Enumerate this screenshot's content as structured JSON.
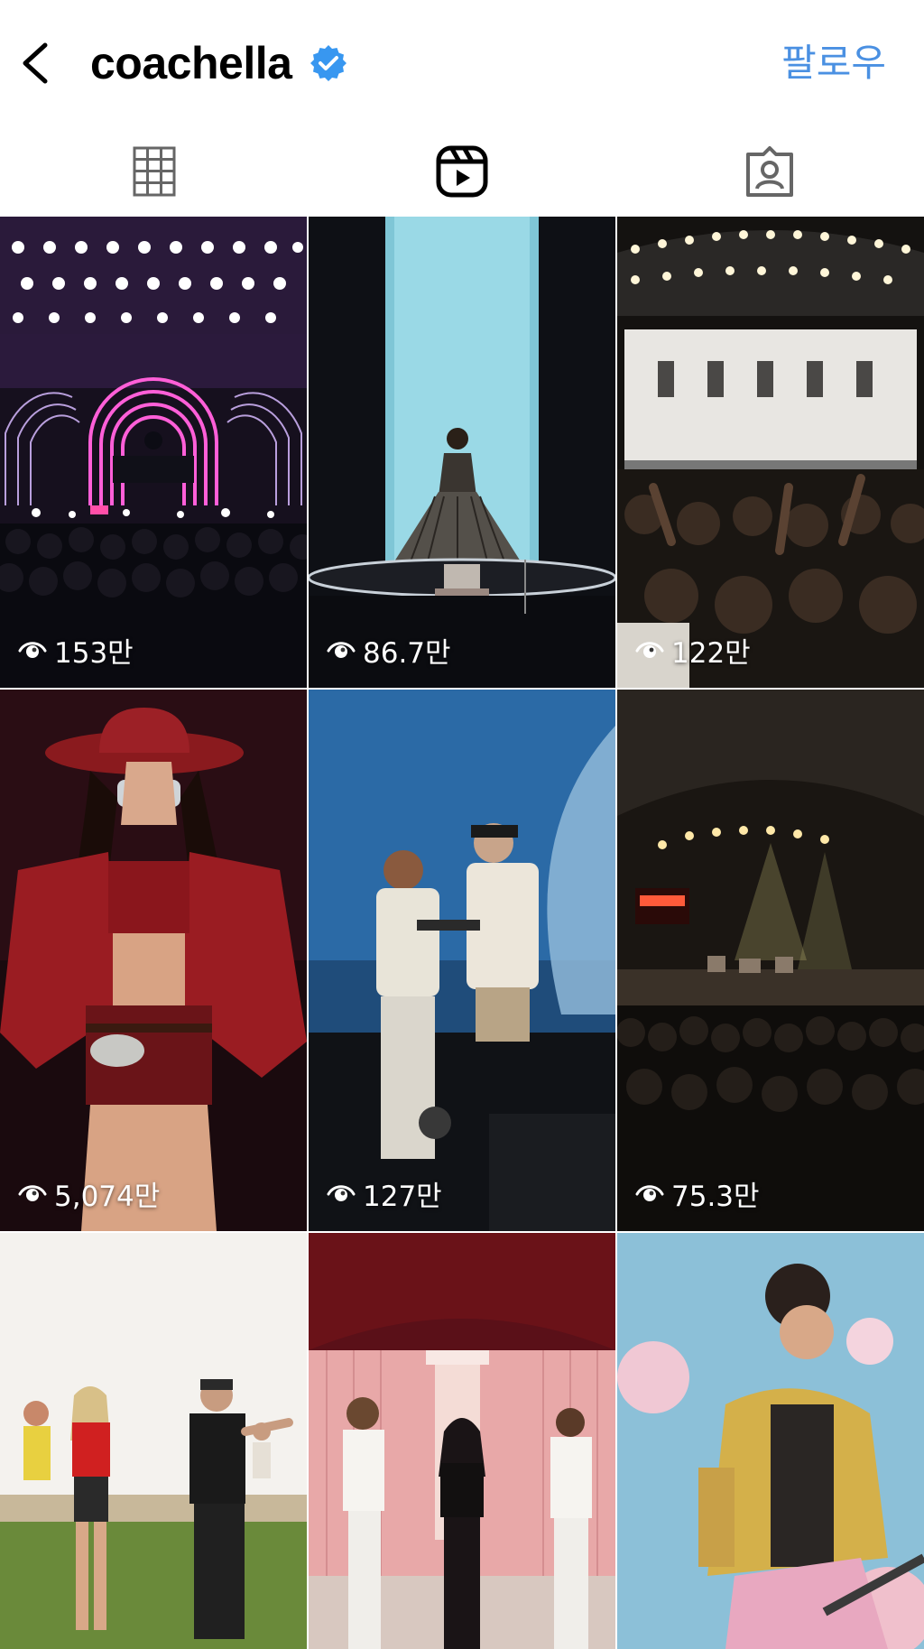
{
  "header": {
    "username": "coachella",
    "follow_label": "팔로우"
  },
  "tabs": [
    {
      "icon": "grid-icon"
    },
    {
      "icon": "reels-icon",
      "active": true
    },
    {
      "icon": "tagged-icon"
    }
  ],
  "reels": [
    {
      "views": "153만",
      "description": "stage with neon arches and lights"
    },
    {
      "views": "86.7만",
      "description": "performer in fringe gown on stage"
    },
    {
      "views": "122만",
      "description": "crowd before stage screens"
    },
    {
      "views": "5,074만",
      "description": "performer in red cowboy hat"
    },
    {
      "views": "127만",
      "description": "two rappers with mics"
    },
    {
      "views": "75.3만",
      "description": "tent stage with band"
    },
    {
      "views": "",
      "description": "festival goers dancing on grass"
    },
    {
      "views": "",
      "description": "dancers on pink stage"
    },
    {
      "views": "",
      "description": "guitarist in yellow jacket"
    }
  ],
  "colors": {
    "accent": "#4a90e2",
    "verified": "#3897f0"
  }
}
